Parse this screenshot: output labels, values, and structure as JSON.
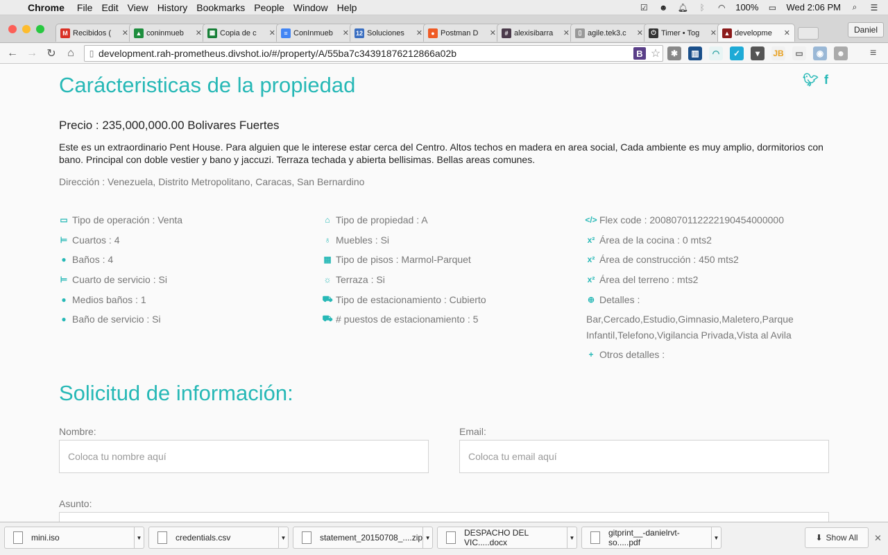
{
  "menubar": {
    "app": "Chrome",
    "items": [
      "File",
      "Edit",
      "View",
      "History",
      "Bookmarks",
      "People",
      "Window",
      "Help"
    ],
    "battery": "100%",
    "clock": "Wed 2:06 PM"
  },
  "tabs": [
    {
      "title": "Recibidos (",
      "color": "#d93025",
      "glyph": "M"
    },
    {
      "title": "coninmueb",
      "color": "#1e8e3e",
      "glyph": "▲"
    },
    {
      "title": "Copia de c",
      "color": "#188038",
      "glyph": "▦"
    },
    {
      "title": "ConInmueb",
      "color": "#4285f4",
      "glyph": "≡"
    },
    {
      "title": "Soluciones",
      "color": "#3b6fc1",
      "glyph": "12"
    },
    {
      "title": "Postman D",
      "color": "#ef5b25",
      "glyph": "●"
    },
    {
      "title": "alexisibarra",
      "color": "#4a3a4a",
      "glyph": "#"
    },
    {
      "title": "agile.tek3.c",
      "color": "#999999",
      "glyph": "▯"
    },
    {
      "title": "Timer • Tog",
      "color": "#333333",
      "glyph": "⏻"
    },
    {
      "title": "developme",
      "color": "#8b1a1a",
      "glyph": "▲"
    }
  ],
  "profile": "Daniel",
  "toolbar": {
    "url": "development.rah-prometheus.divshot.io/#/property/A/55ba7c34391876212866a02b"
  },
  "property": {
    "heading": "Carácteristicas de la propiedad",
    "price": "Precio : 235,000,000.00 Bolivares Fuertes",
    "description": "Este es un extraordinario Pent House. Para alguien que le interese estar cerca del Centro. Altos techos en madera en area social, Cada ambiente es muy amplio, dormitorios con bano. Principal con doble vestier y bano y jaccuzi. Terraza techada y abierta bellisimas. Bellas areas comunes.",
    "address": "Dirección : Venezuela, Distrito Metropolitano, Caracas, San Bernardino",
    "col1": [
      {
        "icon": "credit-card-icon",
        "glyph": "▭",
        "text": "Tipo de operación : Venta"
      },
      {
        "icon": "bed-icon",
        "glyph": "⊨",
        "text": "Cuartos : 4"
      },
      {
        "icon": "tint-icon",
        "glyph": "●",
        "text": "Baños : 4"
      },
      {
        "icon": "bed-icon",
        "glyph": "⊨",
        "text": "Cuarto de servicio : Si"
      },
      {
        "icon": "tint-icon",
        "glyph": "●",
        "text": "Medios baños : 1"
      },
      {
        "icon": "tint-icon",
        "glyph": "●",
        "text": "Baño de servicio : Si"
      }
    ],
    "col2": [
      {
        "icon": "home-icon",
        "glyph": "⌂",
        "text": "Tipo de propiedad : A"
      },
      {
        "icon": "lightbulb-icon",
        "glyph": "♁",
        "text": "Muebles : Si"
      },
      {
        "icon": "th-large-icon",
        "glyph": "▦",
        "text": "Tipo de pisos : Marmol-Parquet"
      },
      {
        "icon": "sun-icon",
        "glyph": "☼",
        "text": "Terraza : Si"
      },
      {
        "icon": "car-icon",
        "glyph": "⛟",
        "text": "Tipo de estacionamiento : Cubierto"
      },
      {
        "icon": "car-icon",
        "glyph": "⛟",
        "text": "# puestos de estacionamiento : 5"
      }
    ],
    "col3": [
      {
        "icon": "code-icon",
        "glyph": "</>",
        "text": "Flex code : 2008070112222190454000000"
      },
      {
        "icon": "superscript-icon",
        "glyph": "x²",
        "text": "Área de la cocina : 0 mts2"
      },
      {
        "icon": "superscript-icon",
        "glyph": "x²",
        "text": "Área de construcción : 450 mts2"
      },
      {
        "icon": "superscript-icon",
        "glyph": "x²",
        "text": "Área del terreno : mts2"
      }
    ],
    "details_label": "Detalles :",
    "details_text": "Bar,Cercado,Estudio,Gimnasio,Maletero,Parque Infantil,Telefono,Vigilancia Privada,Vista al Avila",
    "other_details_label": "Otros detalles :"
  },
  "form": {
    "heading": "Solicitud de información:",
    "name_label": "Nombre:",
    "name_placeholder": "Coloca tu nombre aquí",
    "email_label": "Email:",
    "email_placeholder": "Coloca tu email aquí",
    "subject_label": "Asunto:"
  },
  "downloads": {
    "items": [
      "mini.iso",
      "credentials.csv",
      "statement_20150708_....zip",
      "DESPACHO DEL VIC.....docx",
      "gitprint__-danielrvt-so.....pdf"
    ],
    "show_all": "Show All"
  },
  "colors": {
    "accent": "#26b8b6",
    "muted_text": "#777777"
  }
}
